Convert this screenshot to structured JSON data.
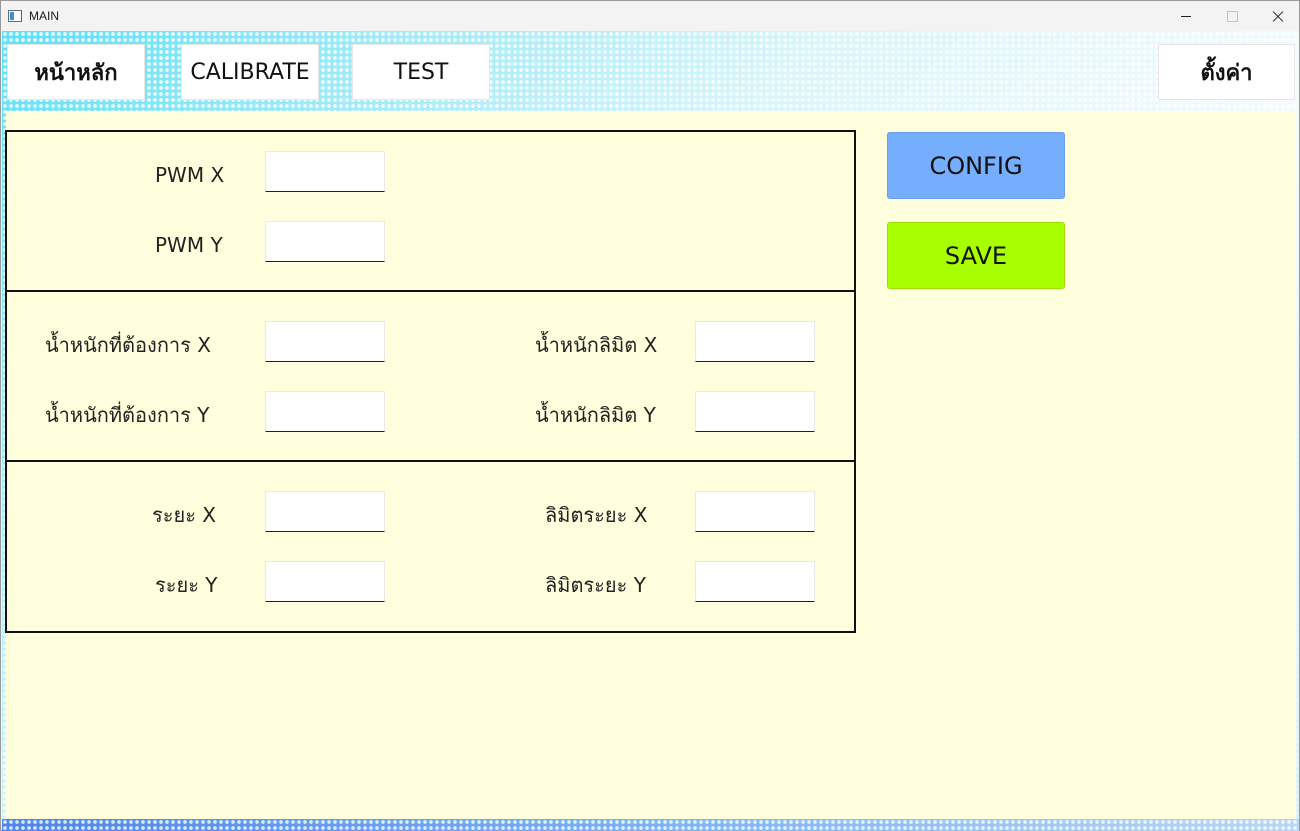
{
  "window": {
    "title": "MAIN"
  },
  "nav": {
    "home_label": "หน้าหลัก",
    "calibrate_label": "CALIBRATE",
    "test_label": "TEST",
    "settings_label": "ตั้งค่า"
  },
  "pwm": {
    "x_label": "PWM X",
    "y_label": "PWM Y",
    "x_value": "",
    "y_value": ""
  },
  "weight": {
    "target_x_label": "น้ำหนักที่ต้องการ X",
    "target_y_label": "น้ำหนักที่ต้องการ Y",
    "limit_x_label": "น้ำหนักลิมิต X",
    "limit_y_label": "น้ำหนักลิมิต Y",
    "target_x_value": "",
    "target_y_value": "",
    "limit_x_value": "",
    "limit_y_value": ""
  },
  "distance": {
    "x_label": "ระยะ X",
    "y_label": "ระยะ Y",
    "limit_x_label": "ลิมิตระยะ X",
    "limit_y_label": "ลิมิตระยะ Y",
    "x_value": "",
    "y_value": "",
    "limit_x_value": "",
    "limit_y_value": ""
  },
  "actions": {
    "config_label": "CONFIG",
    "save_label": "SAVE"
  },
  "colors": {
    "content_bg": "#ffffde",
    "config_button": "#74aefc",
    "save_button": "#a8ff00"
  }
}
